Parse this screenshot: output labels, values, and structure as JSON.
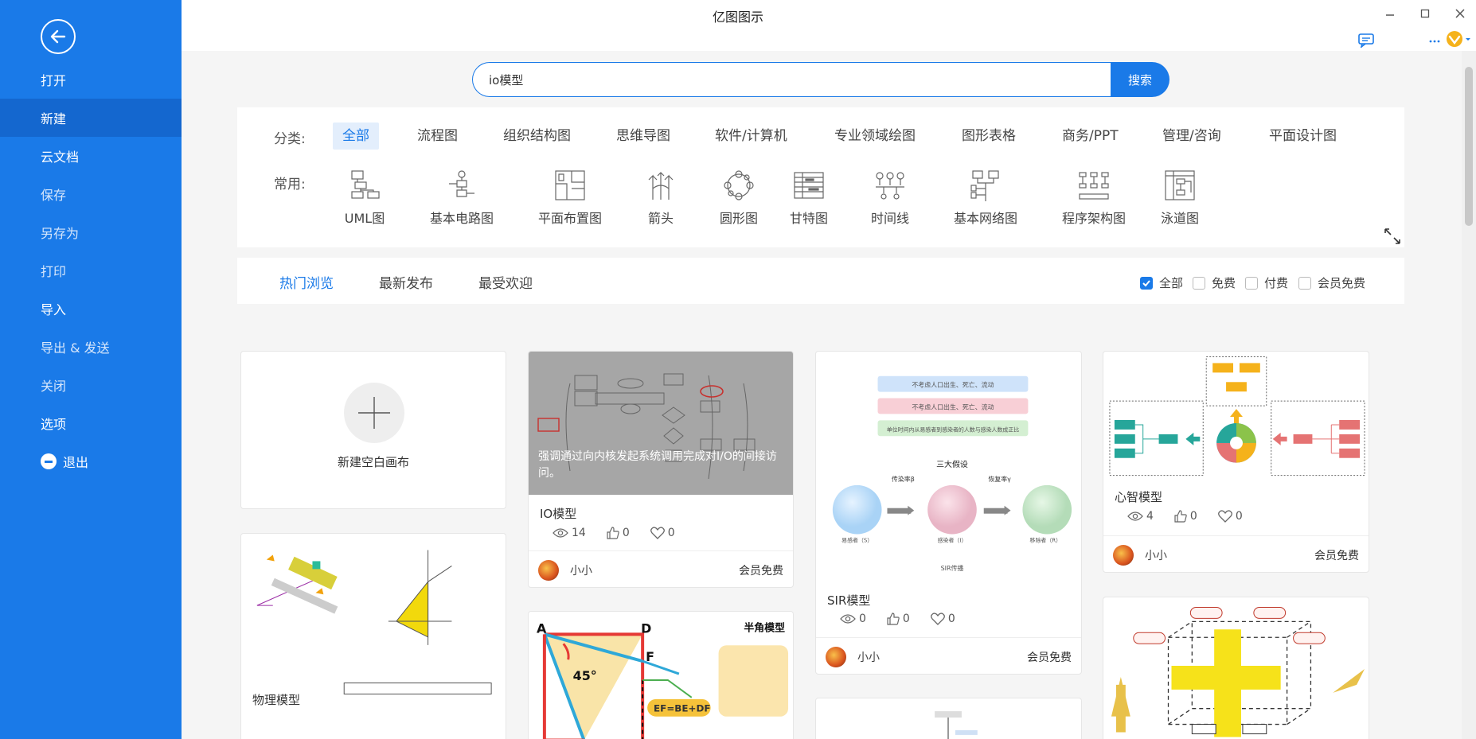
{
  "window": {
    "title": "亿图图示"
  },
  "sidebar": {
    "items": [
      {
        "label": "打开"
      },
      {
        "label": "新建"
      },
      {
        "label": "云文档"
      },
      {
        "label": "保存"
      },
      {
        "label": "另存为"
      },
      {
        "label": "打印"
      },
      {
        "label": "导入"
      },
      {
        "label": "导出 & 发送"
      },
      {
        "label": "关闭"
      },
      {
        "label": "选项"
      },
      {
        "label": "退出"
      }
    ]
  },
  "search": {
    "value": "io模型",
    "button": "搜索"
  },
  "categories": {
    "label": "分类:",
    "tabs": [
      "全部",
      "流程图",
      "组织结构图",
      "思维导图",
      "软件/计算机",
      "专业领域绘图",
      "图形表格",
      "商务/PPT",
      "管理/咨询",
      "平面设计图"
    ],
    "common_label": "常用:",
    "common": [
      "UML图",
      "基本电路图",
      "平面布置图",
      "箭头",
      "圆形图",
      "甘特图",
      "时间线",
      "基本网络图",
      "程序架构图",
      "泳道图"
    ]
  },
  "sort_tabs": [
    "热门浏览",
    "最新发布",
    "最受欢迎"
  ],
  "filters": [
    "全部",
    "免费",
    "付费",
    "会员免费"
  ],
  "new_canvas": {
    "label": "新建空白画布"
  },
  "cards": [
    {
      "title": "IO模型",
      "overlay": "强调通过向内核发起系统调用完成对I/O的间接访问。",
      "views": "14",
      "likes": "0",
      "favs": "0",
      "author": "小小",
      "price": "会员免费"
    },
    {
      "title": "SIR模型",
      "views": "0",
      "likes": "0",
      "favs": "0",
      "author": "小小",
      "price": "会员免费"
    },
    {
      "title": "心智模型",
      "views": "4",
      "likes": "0",
      "favs": "0",
      "author": "小小",
      "price": "会员免费"
    },
    {
      "title": "物理模型"
    }
  ],
  "thumb_text": {
    "sir_box1": "不考虑人口出生、死亡、流动",
    "sir_box2": "不考虑人口出生、死亡、流动",
    "sir_box3": "单位时间内从易感者到感染者的人数与感染人数成正比",
    "sir_heading": "三大假设",
    "sir_arrow1": "传染率β",
    "sir_arrow2": "恢复率γ",
    "sir_s": "易感者（S）",
    "sir_i": "感染者（I）",
    "sir_r": "移除者（R）",
    "sir_foot": "SIR传播",
    "half_title": "半角模型",
    "half_a": "A",
    "half_d": "D",
    "half_f": "F",
    "half_angle": "45°",
    "half_eq": "EF=BE+DF"
  },
  "colors": {
    "accent": "#1a7ae8",
    "sidebar": "#1a7ae8",
    "sidebar_active": "#1467cf"
  }
}
